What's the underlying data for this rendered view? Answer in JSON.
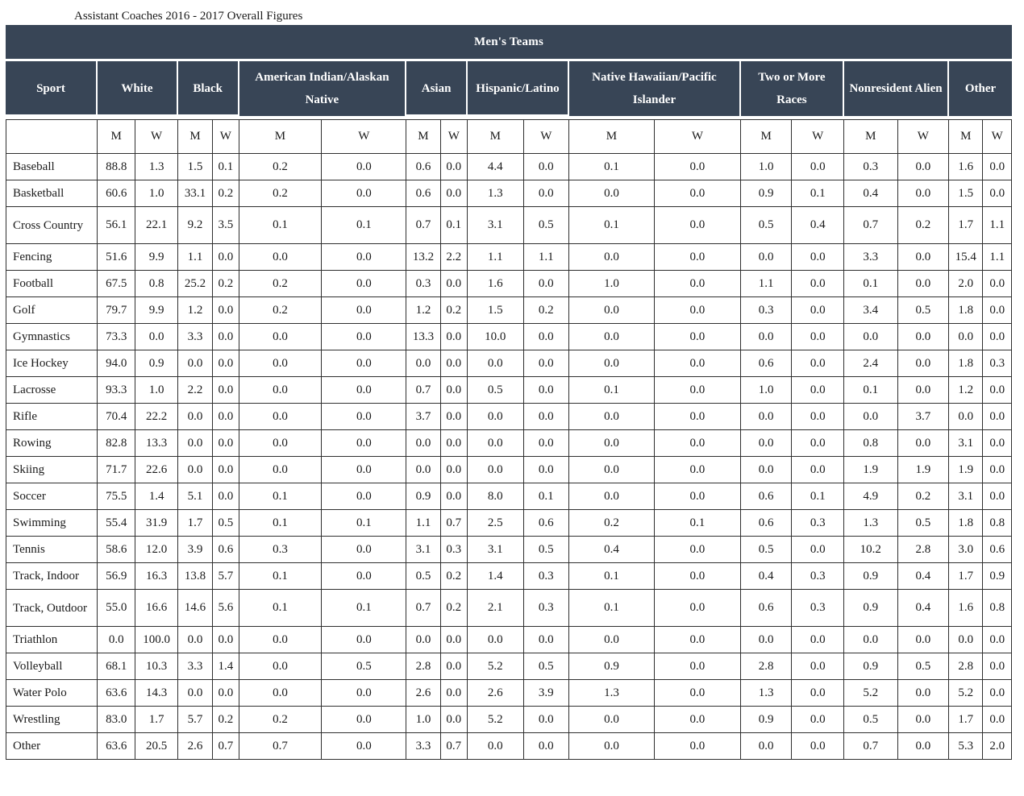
{
  "caption": "Assistant Coaches 2016 - 2017 Overall Figures",
  "group_title": "Men's Teams",
  "sport_header": "Sport",
  "groups": [
    "White",
    "Black",
    "American Indian/Alaskan Native",
    "Asian",
    "Hispanic/Latino",
    "Native Hawaiian/Pacific Islander",
    "Two or More Races",
    "Nonresident Alien",
    "Other"
  ],
  "sub_headers": [
    "M",
    "W"
  ],
  "colors": {
    "header_bg": "#384556",
    "header_text": "#ffffff",
    "border": "#2f2f2f"
  },
  "rows": [
    {
      "sport": "Baseball",
      "values": [
        "88.8",
        "1.3",
        "1.5",
        "0.1",
        "0.2",
        "0.0",
        "0.6",
        "0.0",
        "4.4",
        "0.0",
        "0.1",
        "0.0",
        "1.0",
        "0.0",
        "0.3",
        "0.0",
        "1.6",
        "0.0"
      ]
    },
    {
      "sport": "Basketball",
      "values": [
        "60.6",
        "1.0",
        "33.1",
        "0.2",
        "0.2",
        "0.0",
        "0.6",
        "0.0",
        "1.3",
        "0.0",
        "0.0",
        "0.0",
        "0.9",
        "0.1",
        "0.4",
        "0.0",
        "1.5",
        "0.0"
      ]
    },
    {
      "sport": "Cross Country",
      "values": [
        "56.1",
        "22.1",
        "9.2",
        "3.5",
        "0.1",
        "0.1",
        "0.7",
        "0.1",
        "3.1",
        "0.5",
        "0.1",
        "0.0",
        "0.5",
        "0.4",
        "0.7",
        "0.2",
        "1.7",
        "1.1"
      ]
    },
    {
      "sport": "Fencing",
      "values": [
        "51.6",
        "9.9",
        "1.1",
        "0.0",
        "0.0",
        "0.0",
        "13.2",
        "2.2",
        "1.1",
        "1.1",
        "0.0",
        "0.0",
        "0.0",
        "0.0",
        "3.3",
        "0.0",
        "15.4",
        "1.1"
      ]
    },
    {
      "sport": "Football",
      "values": [
        "67.5",
        "0.8",
        "25.2",
        "0.2",
        "0.2",
        "0.0",
        "0.3",
        "0.0",
        "1.6",
        "0.0",
        "1.0",
        "0.0",
        "1.1",
        "0.0",
        "0.1",
        "0.0",
        "2.0",
        "0.0"
      ]
    },
    {
      "sport": "Golf",
      "values": [
        "79.7",
        "9.9",
        "1.2",
        "0.0",
        "0.2",
        "0.0",
        "1.2",
        "0.2",
        "1.5",
        "0.2",
        "0.0",
        "0.0",
        "0.3",
        "0.0",
        "3.4",
        "0.5",
        "1.8",
        "0.0"
      ]
    },
    {
      "sport": "Gymnastics",
      "values": [
        "73.3",
        "0.0",
        "3.3",
        "0.0",
        "0.0",
        "0.0",
        "13.3",
        "0.0",
        "10.0",
        "0.0",
        "0.0",
        "0.0",
        "0.0",
        "0.0",
        "0.0",
        "0.0",
        "0.0",
        "0.0"
      ]
    },
    {
      "sport": "Ice Hockey",
      "values": [
        "94.0",
        "0.9",
        "0.0",
        "0.0",
        "0.0",
        "0.0",
        "0.0",
        "0.0",
        "0.0",
        "0.0",
        "0.0",
        "0.0",
        "0.6",
        "0.0",
        "2.4",
        "0.0",
        "1.8",
        "0.3"
      ]
    },
    {
      "sport": "Lacrosse",
      "values": [
        "93.3",
        "1.0",
        "2.2",
        "0.0",
        "0.0",
        "0.0",
        "0.7",
        "0.0",
        "0.5",
        "0.0",
        "0.1",
        "0.0",
        "1.0",
        "0.0",
        "0.1",
        "0.0",
        "1.2",
        "0.0"
      ]
    },
    {
      "sport": "Rifle",
      "values": [
        "70.4",
        "22.2",
        "0.0",
        "0.0",
        "0.0",
        "0.0",
        "3.7",
        "0.0",
        "0.0",
        "0.0",
        "0.0",
        "0.0",
        "0.0",
        "0.0",
        "0.0",
        "3.7",
        "0.0",
        "0.0"
      ]
    },
    {
      "sport": "Rowing",
      "values": [
        "82.8",
        "13.3",
        "0.0",
        "0.0",
        "0.0",
        "0.0",
        "0.0",
        "0.0",
        "0.0",
        "0.0",
        "0.0",
        "0.0",
        "0.0",
        "0.0",
        "0.8",
        "0.0",
        "3.1",
        "0.0"
      ]
    },
    {
      "sport": "Skiing",
      "values": [
        "71.7",
        "22.6",
        "0.0",
        "0.0",
        "0.0",
        "0.0",
        "0.0",
        "0.0",
        "0.0",
        "0.0",
        "0.0",
        "0.0",
        "0.0",
        "0.0",
        "1.9",
        "1.9",
        "1.9",
        "0.0"
      ]
    },
    {
      "sport": "Soccer",
      "values": [
        "75.5",
        "1.4",
        "5.1",
        "0.0",
        "0.1",
        "0.0",
        "0.9",
        "0.0",
        "8.0",
        "0.1",
        "0.0",
        "0.0",
        "0.6",
        "0.1",
        "4.9",
        "0.2",
        "3.1",
        "0.0"
      ]
    },
    {
      "sport": "Swimming",
      "values": [
        "55.4",
        "31.9",
        "1.7",
        "0.5",
        "0.1",
        "0.1",
        "1.1",
        "0.7",
        "2.5",
        "0.6",
        "0.2",
        "0.1",
        "0.6",
        "0.3",
        "1.3",
        "0.5",
        "1.8",
        "0.8"
      ]
    },
    {
      "sport": "Tennis",
      "values": [
        "58.6",
        "12.0",
        "3.9",
        "0.6",
        "0.3",
        "0.0",
        "3.1",
        "0.3",
        "3.1",
        "0.5",
        "0.4",
        "0.0",
        "0.5",
        "0.0",
        "10.2",
        "2.8",
        "3.0",
        "0.6"
      ]
    },
    {
      "sport": "Track, Indoor",
      "values": [
        "56.9",
        "16.3",
        "13.8",
        "5.7",
        "0.1",
        "0.0",
        "0.5",
        "0.2",
        "1.4",
        "0.3",
        "0.1",
        "0.0",
        "0.4",
        "0.3",
        "0.9",
        "0.4",
        "1.7",
        "0.9"
      ]
    },
    {
      "sport": "Track, Outdoor",
      "values": [
        "55.0",
        "16.6",
        "14.6",
        "5.6",
        "0.1",
        "0.1",
        "0.7",
        "0.2",
        "2.1",
        "0.3",
        "0.1",
        "0.0",
        "0.6",
        "0.3",
        "0.9",
        "0.4",
        "1.6",
        "0.8"
      ]
    },
    {
      "sport": "Triathlon",
      "values": [
        "0.0",
        "100.0",
        "0.0",
        "0.0",
        "0.0",
        "0.0",
        "0.0",
        "0.0",
        "0.0",
        "0.0",
        "0.0",
        "0.0",
        "0.0",
        "0.0",
        "0.0",
        "0.0",
        "0.0",
        "0.0"
      ]
    },
    {
      "sport": "Volleyball",
      "values": [
        "68.1",
        "10.3",
        "3.3",
        "1.4",
        "0.0",
        "0.5",
        "2.8",
        "0.0",
        "5.2",
        "0.5",
        "0.9",
        "0.0",
        "2.8",
        "0.0",
        "0.9",
        "0.5",
        "2.8",
        "0.0"
      ]
    },
    {
      "sport": "Water Polo",
      "values": [
        "63.6",
        "14.3",
        "0.0",
        "0.0",
        "0.0",
        "0.0",
        "2.6",
        "0.0",
        "2.6",
        "3.9",
        "1.3",
        "0.0",
        "1.3",
        "0.0",
        "5.2",
        "0.0",
        "5.2",
        "0.0"
      ]
    },
    {
      "sport": "Wrestling",
      "values": [
        "83.0",
        "1.7",
        "5.7",
        "0.2",
        "0.2",
        "0.0",
        "1.0",
        "0.0",
        "5.2",
        "0.0",
        "0.0",
        "0.0",
        "0.9",
        "0.0",
        "0.5",
        "0.0",
        "1.7",
        "0.0"
      ]
    },
    {
      "sport": "Other",
      "values": [
        "63.6",
        "20.5",
        "2.6",
        "0.7",
        "0.7",
        "0.0",
        "3.3",
        "0.7",
        "0.0",
        "0.0",
        "0.0",
        "0.0",
        "0.0",
        "0.0",
        "0.7",
        "0.0",
        "5.3",
        "2.0"
      ]
    }
  ]
}
